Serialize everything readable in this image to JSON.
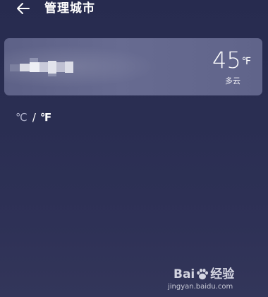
{
  "header": {
    "back_icon": "arrow-left-icon",
    "title": "管理城市"
  },
  "city_card": {
    "city_name_obscured": true,
    "temperature": "45",
    "temperature_unit": "℉",
    "condition": "多云"
  },
  "unit_toggle": {
    "celsius": "℃",
    "separator": "/",
    "fahrenheit": "℉",
    "selected": "fahrenheit"
  },
  "watermark": {
    "logo_text": "Bai",
    "logo_text_2": "经验",
    "url": "jingyan.baidu.com"
  },
  "colors": {
    "background_top": "#272b4f",
    "background_bottom": "#33365a",
    "card": "#64688e",
    "text": "#ffffff",
    "muted_text": "#a9acc6"
  }
}
